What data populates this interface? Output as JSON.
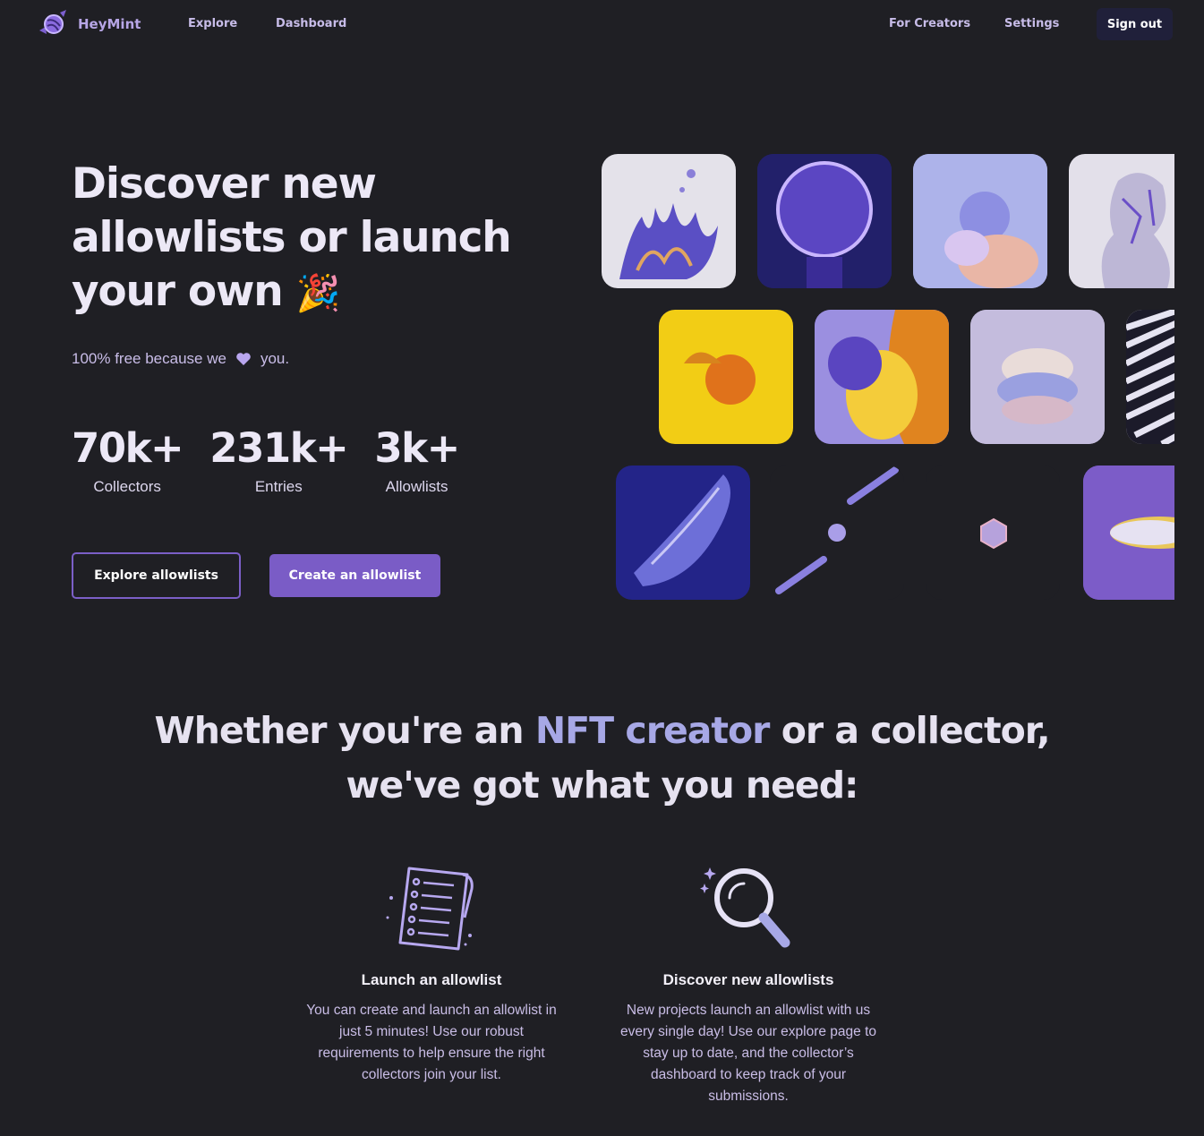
{
  "brand": {
    "name": "HeyMint"
  },
  "nav": {
    "links": [
      "Explore",
      "Dashboard"
    ],
    "right_links": [
      "For Creators",
      "Settings"
    ],
    "signout_label": "Sign out"
  },
  "hero": {
    "title_line1": "Discover new",
    "title_line2": "allowlists or launch",
    "title_line3": "your own",
    "title_emoji": "🎉",
    "subtitle_before": "100% free because we",
    "subtitle_after": "you.",
    "stats": [
      {
        "value": "70k+",
        "label": "Collectors"
      },
      {
        "value": "231k+",
        "label": "Entries"
      },
      {
        "value": "3k+",
        "label": "Allowlists"
      }
    ],
    "explore_button": "Explore allowlists",
    "create_button": "Create an allowlist"
  },
  "section": {
    "title_before": "Whether you're an",
    "title_accent": "NFT creator",
    "title_after": "or a collector,",
    "title_line2": "we've got what you need:",
    "features": [
      {
        "icon": "checklist-icon",
        "title": "Launch an allowlist",
        "text": "You can create and launch an allowlist in just 5 minutes! Use our robust requirements to help ensure the right collectors join your list."
      },
      {
        "icon": "magnifier-icon",
        "title": "Discover new allowlists",
        "text": "New projects launch an allowlist with us every single day! Use our explore page to stay up to date, and the collector’s dashboard to keep track of your submissions."
      }
    ]
  },
  "colors": {
    "background": "#1f1f24",
    "accent": "#7a5cc6",
    "heart": "#b9a6ef"
  }
}
